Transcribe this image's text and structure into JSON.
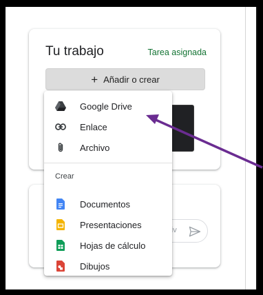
{
  "work": {
    "title": "Tu trabajo",
    "status": "Tarea asignada",
    "add_label": "Añadir o crear"
  },
  "menu": {
    "attach_items": [
      {
        "label": "Google Drive",
        "icon": "google-drive-icon"
      },
      {
        "label": "Enlace",
        "icon": "link-icon"
      },
      {
        "label": "Archivo",
        "icon": "paperclip-icon"
      }
    ],
    "create_section_label": "Crear",
    "create_items": [
      {
        "label": "Documentos",
        "icon": "google-docs-icon",
        "color": "#4285f4"
      },
      {
        "label": "Presentaciones",
        "icon": "google-slides-icon",
        "color": "#f4b400"
      },
      {
        "label": "Hojas de cálculo",
        "icon": "google-sheets-icon",
        "color": "#0f9d58"
      },
      {
        "label": "Dibujos",
        "icon": "google-drawings-icon",
        "color": "#db4437"
      }
    ]
  },
  "comments": {
    "placeholder_fragment": "priv"
  },
  "colors": {
    "status_green": "#137333",
    "annotation_arrow": "#6a2c91"
  }
}
